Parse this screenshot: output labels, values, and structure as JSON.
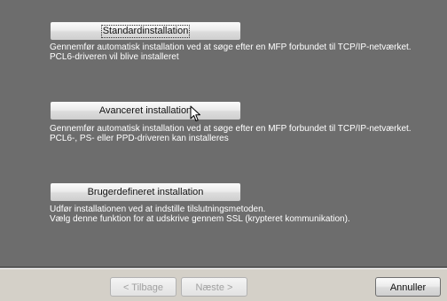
{
  "options": {
    "standard": {
      "label": "Standardinstallation",
      "desc_line1": "Gennemfør automatisk installation ved at søge efter en MFP forbundet til TCP/IP-netværket.",
      "desc_line2": "PCL6-driveren vil blive installeret"
    },
    "advanced": {
      "label": "Avanceret installation",
      "desc_line1": "Gennemfør automatisk installation ved at søge efter en MFP forbundet til TCP/IP-netværket.",
      "desc_line2": "PCL6-, PS- eller PPD-driveren kan installeres"
    },
    "custom": {
      "label": "Brugerdefineret installation",
      "desc_line1": "Udfør installationen ved at indstille tilslutningsmetoden.",
      "desc_line2": "Vælg denne funktion for at udskrive gennem SSL (krypteret kommunikation)."
    }
  },
  "nav": {
    "back_label": "< Tilbage",
    "next_label": "Næste >",
    "cancel_label": "Annuller"
  },
  "colors": {
    "panel_bg": "#6d6d6d",
    "nav_bg": "#d4d0c8",
    "desc_text": "#ffffff"
  }
}
